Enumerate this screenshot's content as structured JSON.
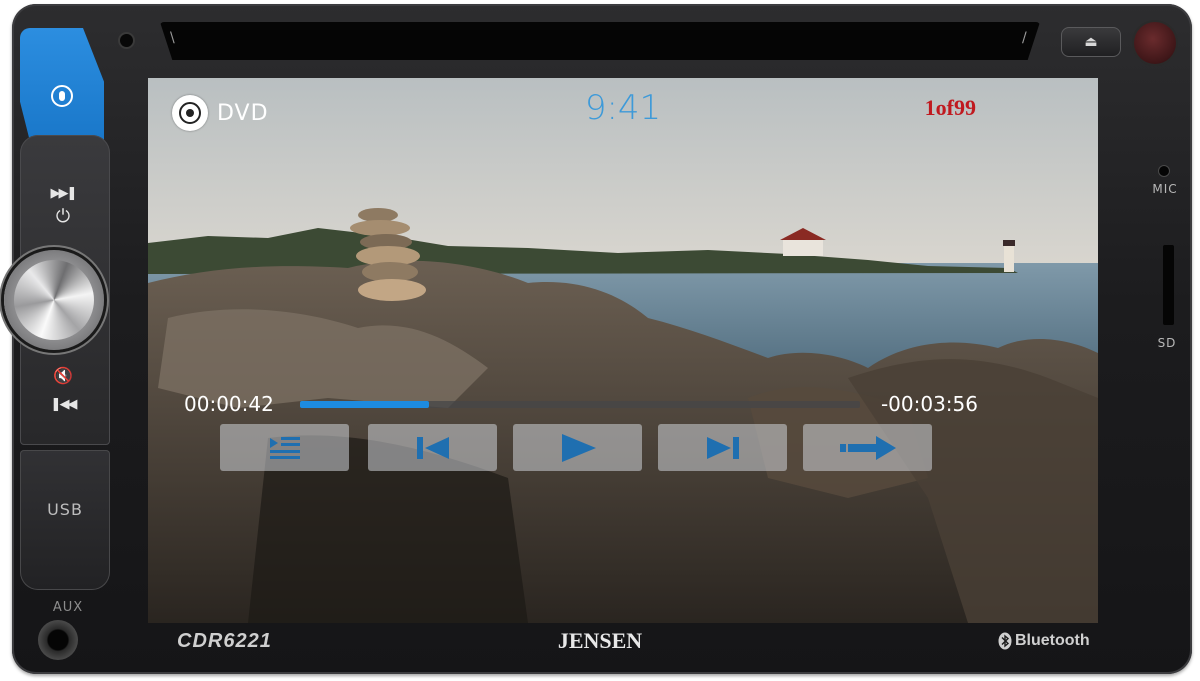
{
  "header": {
    "source_label": "DVD",
    "clock": "9:41",
    "track_info": "1of99"
  },
  "playback": {
    "elapsed": "00:00:42",
    "remaining": "-00:03:56",
    "progress_fraction": 0.23
  },
  "controls": [
    {
      "name": "menu-button",
      "icon": "menu-list-icon"
    },
    {
      "name": "previous-button",
      "icon": "skip-previous-icon"
    },
    {
      "name": "play-button",
      "icon": "play-icon"
    },
    {
      "name": "next-button",
      "icon": "skip-next-icon"
    },
    {
      "name": "forward-button",
      "icon": "arrow-right-icon"
    }
  ],
  "device": {
    "model": "CDR6221",
    "brand": "JENSEN",
    "bluetooth_label": "Bluetooth",
    "usb_label": "USB",
    "aux_label": "AUX",
    "mic_label": "MIC",
    "sd_label": "SD",
    "side_buttons": [
      "mic-button",
      "next-power-button",
      "volume-knob",
      "mute-previous-button",
      "usb-port"
    ]
  },
  "colors": {
    "accent_blue": "#1d8be0",
    "clock_blue": "#3d9ad9",
    "track_red": "#c0191f",
    "mic_button_blue": "#1673c5"
  }
}
